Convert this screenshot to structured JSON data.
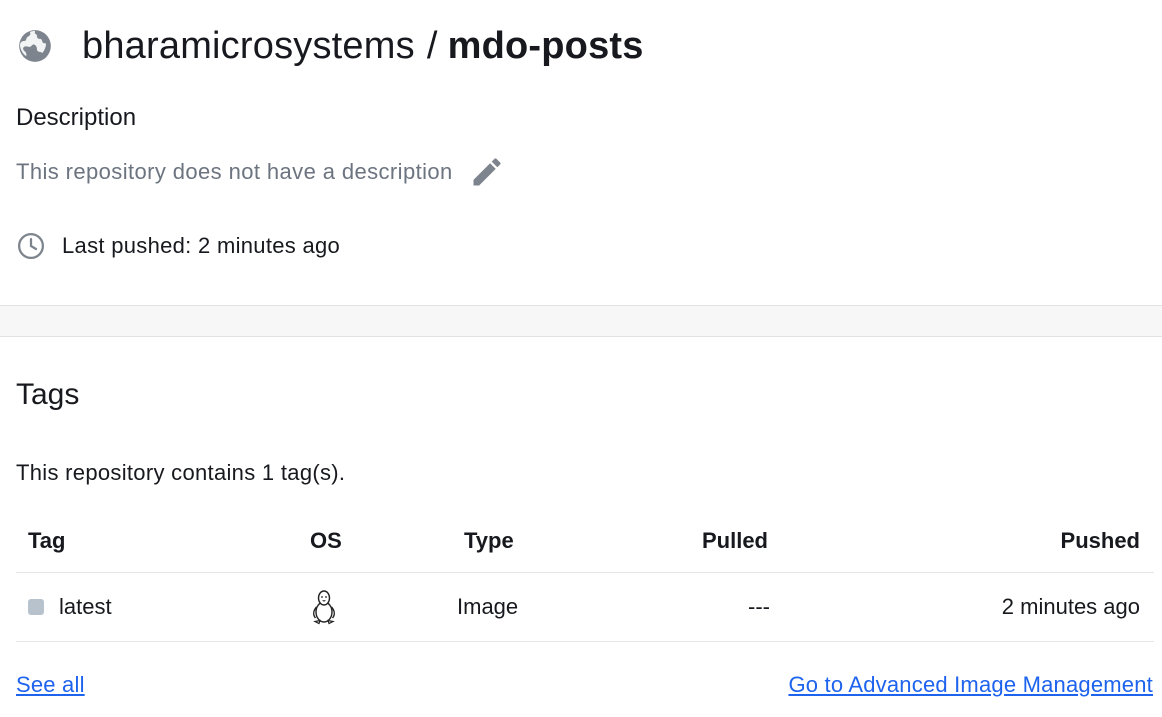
{
  "header": {
    "namespace": "bharamicrosystems",
    "separator": "/",
    "repo_name": "mdo-posts"
  },
  "description": {
    "heading": "Description",
    "text": "This repository does not have a description"
  },
  "last_pushed": {
    "text": "Last pushed: 2 minutes ago"
  },
  "tags": {
    "heading": "Tags",
    "count_text": "This repository contains 1 tag(s).",
    "columns": [
      "Tag",
      "OS",
      "Type",
      "Pulled",
      "Pushed"
    ],
    "rows": [
      {
        "tag": "latest",
        "os_icon": "linux-icon",
        "type": "Image",
        "pulled": "---",
        "pushed": "2 minutes ago"
      }
    ]
  },
  "links": {
    "see_all": "See all",
    "advanced": "Go to Advanced Image Management"
  },
  "colors": {
    "link": "#1d63ed",
    "muted_text": "#6c7480",
    "icon_gray": "#7d848d"
  },
  "icons": [
    "globe-icon",
    "edit-icon",
    "clock-icon",
    "linux-icon"
  ]
}
